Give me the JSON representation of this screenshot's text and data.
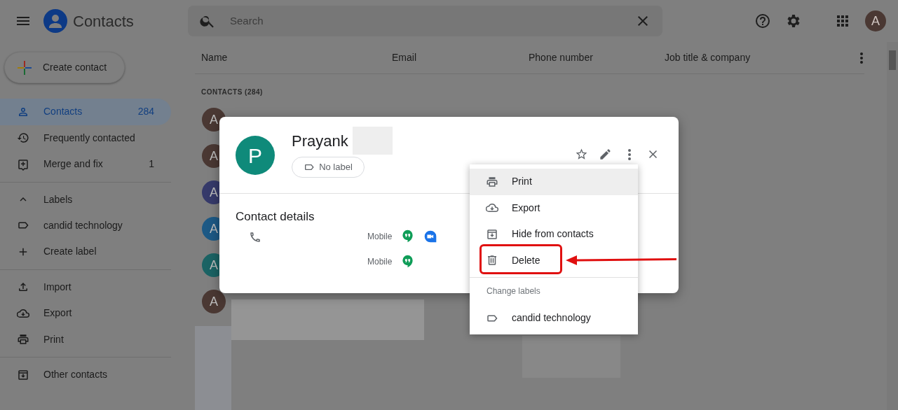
{
  "header": {
    "app_title": "Contacts",
    "search_placeholder": "Search",
    "account_avatar": "A"
  },
  "create_button": "Create contact",
  "sidebar": {
    "sections": [
      {
        "items": [
          {
            "label": "Contacts",
            "count": "284",
            "selected": true
          },
          {
            "label": "Frequently contacted",
            "selected": false
          },
          {
            "label": "Merge and fix",
            "count": "1",
            "selected": false
          }
        ]
      },
      {
        "header": {
          "label": "Labels",
          "expanded": true
        },
        "items": [
          {
            "label": "candid technology",
            "selected": false
          },
          {
            "label": "Create label",
            "selected": false
          }
        ]
      },
      {
        "items": [
          {
            "label": "Import",
            "selected": false
          },
          {
            "label": "Export",
            "selected": false
          },
          {
            "label": "Print",
            "selected": false
          }
        ]
      },
      {
        "items": [
          {
            "label": "Other contacts",
            "selected": false
          }
        ]
      }
    ]
  },
  "table": {
    "columns": [
      "Name",
      "Email",
      "Phone number",
      "Job title & company"
    ],
    "list_heading": "CONTACTS (284)",
    "rows": [
      {
        "avatar": "A",
        "color": "#4a3833"
      },
      {
        "avatar": "A",
        "color": "#4a3833"
      },
      {
        "avatar": "A",
        "color": "#363a6a"
      },
      {
        "avatar": "A",
        "color": "#1d5985"
      },
      {
        "avatar": "A",
        "color": "#1b6364"
      },
      {
        "avatar": "A",
        "color": "#4a3833"
      }
    ]
  },
  "dialog": {
    "avatar": "P",
    "name": "Prayank",
    "label_chip": "No label",
    "section_title": "Contact details",
    "phones": [
      {
        "type": "Mobile",
        "hangouts": true,
        "duo": true
      },
      {
        "type": "Mobile",
        "hangouts": true,
        "duo": false
      }
    ]
  },
  "menu": {
    "items": [
      {
        "label": "Print",
        "selected": true,
        "annotated": false
      },
      {
        "label": "Export",
        "selected": false,
        "annotated": false
      },
      {
        "label": "Hide from contacts",
        "selected": false,
        "annotated": false
      },
      {
        "label": "Delete",
        "selected": false,
        "annotated": true
      }
    ],
    "labels_heading": "Change labels",
    "labels": [
      {
        "label": "candid technology"
      }
    ]
  }
}
